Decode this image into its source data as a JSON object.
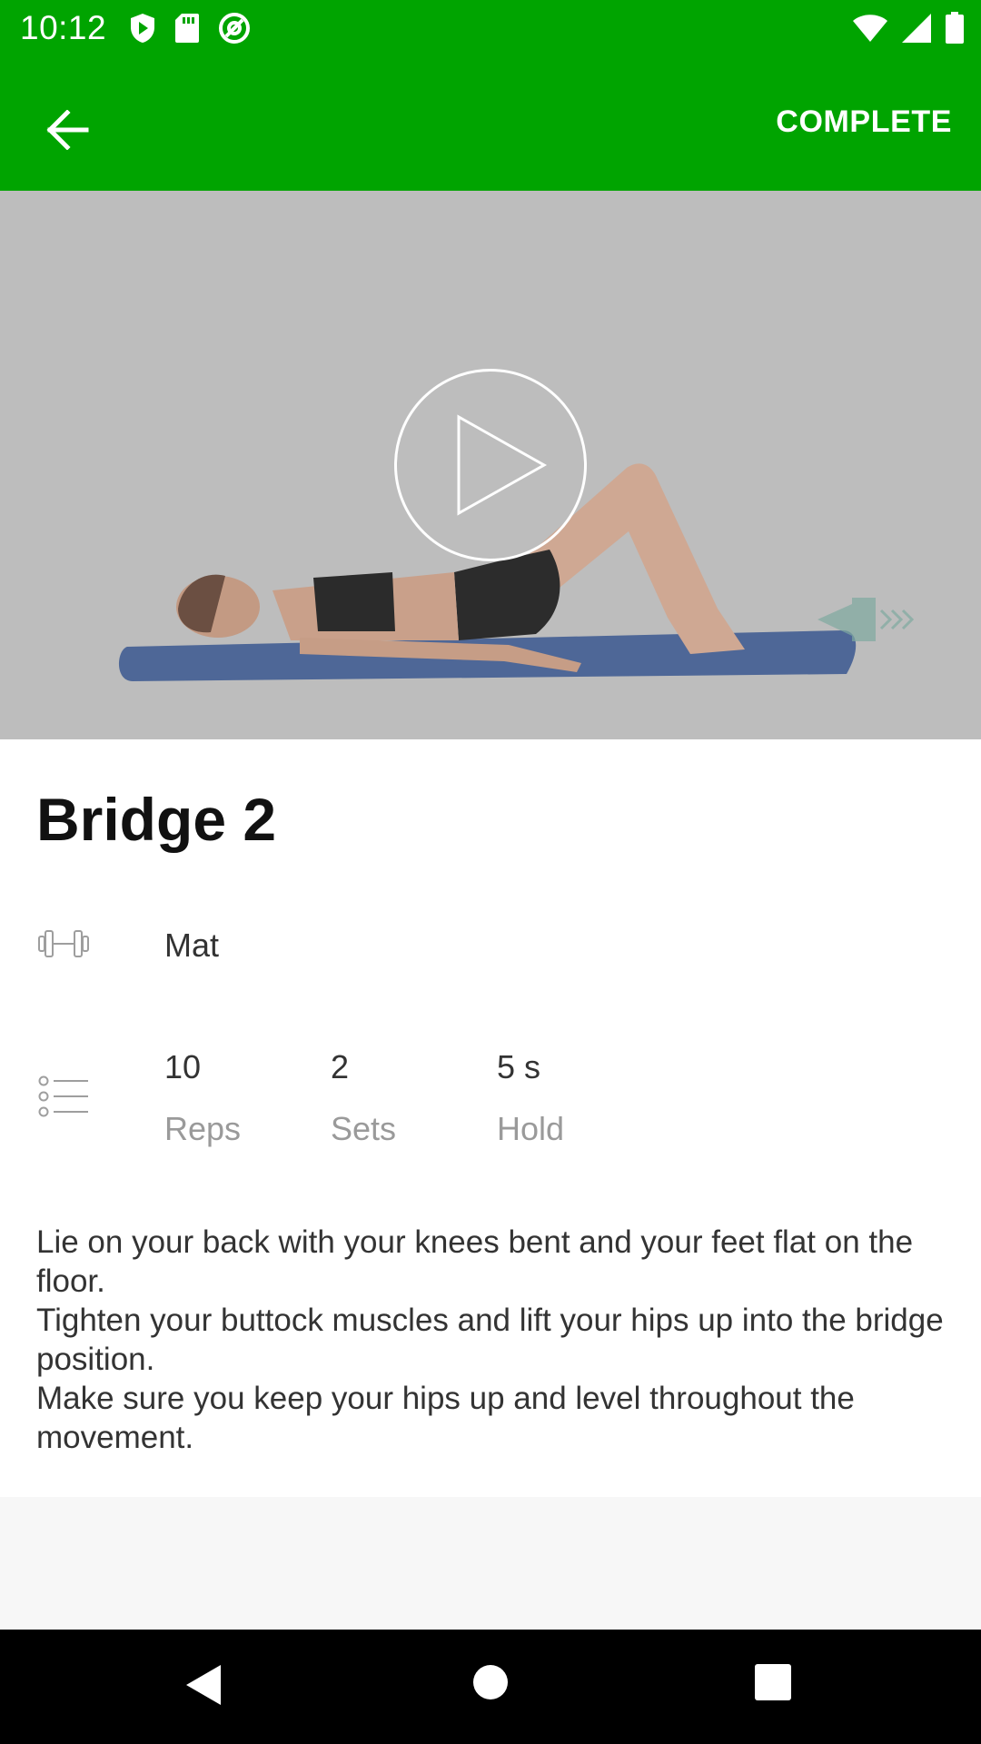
{
  "status_bar": {
    "time": "10:12",
    "icons": [
      "play-protect-icon",
      "sd-card-icon",
      "at-sign-icon",
      "wifi-icon",
      "signal-icon",
      "battery-icon"
    ]
  },
  "toolbar": {
    "back_icon": "arrow-left-icon",
    "complete_label": "COMPLETE",
    "background_color": "#00a400"
  },
  "video": {
    "play_icon": "play-icon"
  },
  "exercise": {
    "title": "Bridge 2",
    "equipment": {
      "icon": "dumbbell-icon",
      "label": "Mat"
    },
    "stats": [
      {
        "value": "10",
        "label": "Reps"
      },
      {
        "value": "2",
        "label": "Sets"
      },
      {
        "value": "5 s",
        "label": "Hold"
      }
    ],
    "stats_icon": "list-icon",
    "instructions": [
      "Lie on your back with your knees bent and your feet flat on the floor.",
      "Tighten your buttock muscles and lift your hips up into the bridge position.",
      "Make sure you keep your hips up and level throughout the movement."
    ]
  },
  "nav_bar": {
    "buttons": [
      "back-triangle-icon",
      "home-circle-icon",
      "recents-square-icon"
    ]
  }
}
